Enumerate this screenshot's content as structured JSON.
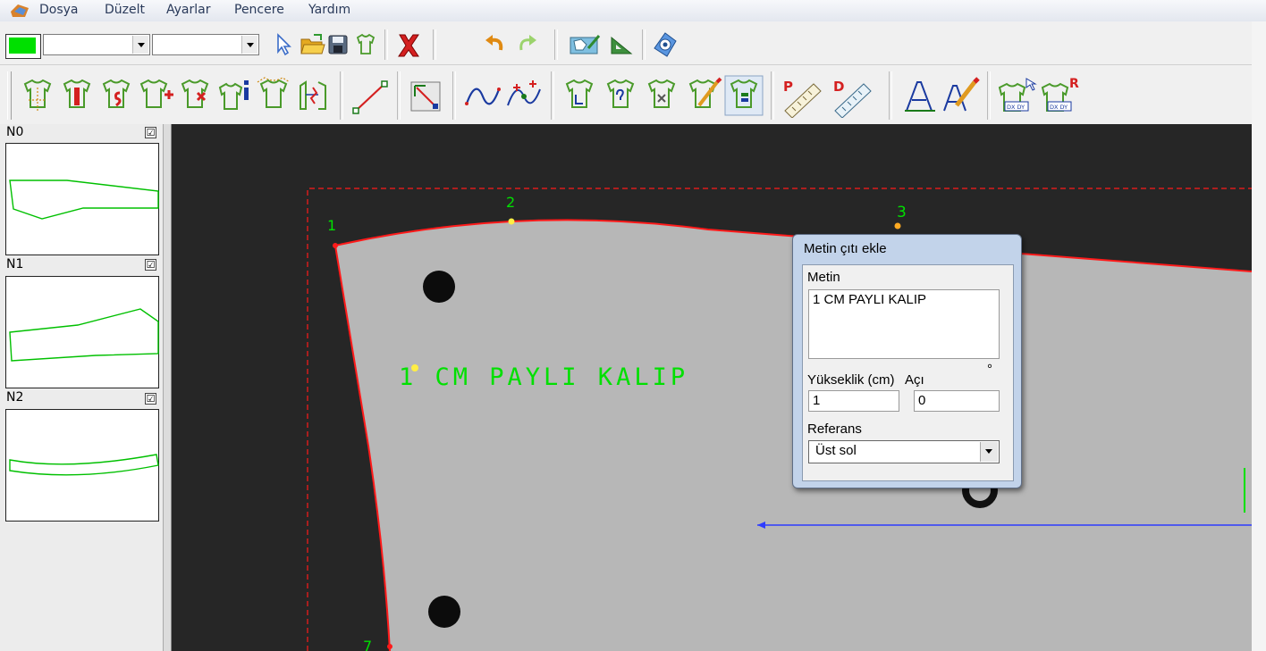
{
  "menu": {
    "items": [
      "Dosya",
      "Düzelt",
      "Ayarlar",
      "Pencere",
      "Yardım"
    ],
    "app_icon": "app-logo-icon"
  },
  "toolbar1": {
    "color_swatch": "#00e000",
    "combo1_value": "",
    "combo2_value": "",
    "icons": [
      "select-arrow-icon",
      "open-folder-icon",
      "save-disk-icon",
      "garment-icon",
      "delete-x-icon",
      "undo-icon",
      "redo-icon",
      "scan-pattern-icon",
      "measure-triangle-icon",
      "help-disc-icon"
    ]
  },
  "toolbar2": {
    "icons": [
      "piece-notch-icon",
      "piece-cut-icon",
      "piece-split-icon",
      "piece-add-icon",
      "piece-delete-icon",
      "piece-info-icon",
      "piece-outline-icon",
      "piece-distance-icon",
      "line-draw-icon",
      "corner-select-icon",
      "curve-icon",
      "curve-points-icon",
      "piece-grade-icon",
      "piece-query-icon",
      "piece-remove-icon",
      "piece-edit-icon",
      "piece-stack-icon",
      "ruler-p-icon",
      "ruler-d-icon",
      "text-icon",
      "text-edit-icon",
      "dxdy-r-icon",
      "dxdy-r2-icon"
    ],
    "ruler_p_label": "P",
    "ruler_d_label": "D",
    "dxdy_label": "DX DY",
    "dxdy_r_label": "R"
  },
  "nodes": [
    {
      "label": "N0",
      "checked": "☑"
    },
    {
      "label": "N1",
      "checked": "☑"
    },
    {
      "label": "N2",
      "checked": "☑"
    }
  ],
  "canvas": {
    "point_labels": [
      "1",
      "2",
      "3",
      "7"
    ],
    "overlay_text": "1 CM PAYLI KALIP",
    "colors": {
      "outline": "#ff1a1a",
      "labels": "#00e000",
      "guide": "#2d3cff",
      "background": "#262626",
      "pattern_fill": "#b7b7b7"
    }
  },
  "dialog": {
    "title": "Metin çıtı ekle",
    "metin_label": "Metin",
    "metin_value": "1 CM PAYLI KALIP",
    "yukseklik_label": "Yükseklik (cm)",
    "aci_label": "Açı",
    "degree_symbol": "°",
    "yukseklik_value": "1",
    "aci_value": "0",
    "referans_label": "Referans",
    "referans_value": "Üst sol"
  }
}
